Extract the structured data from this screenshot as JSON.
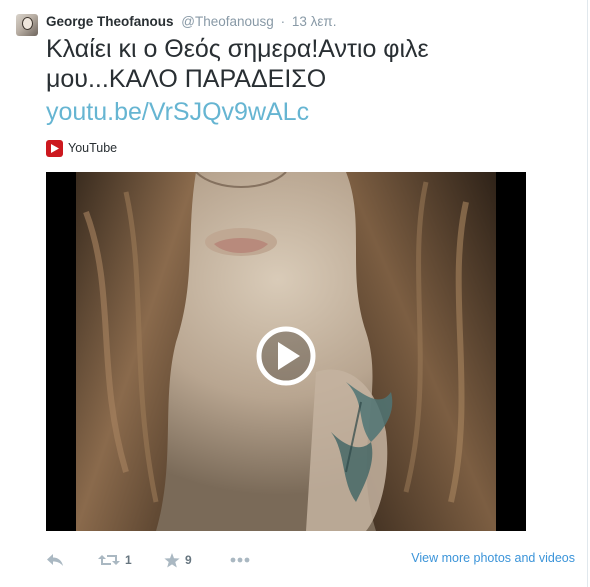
{
  "tweet": {
    "fullname": "George Theofanous",
    "username": "@Theofanousg",
    "separator": "·",
    "time": "13 λεπ.",
    "text": "Κλαίει κι ο Θεός σημερα!Αντιο φιλε μου...ΚΑΛΟ ΠΑΡΑΔΕΙΣΟ",
    "link": "youtu.be/VrSJQv9wALc"
  },
  "card": {
    "source_label": "YouTube",
    "source_icon": "youtube-icon",
    "source_color": "#cc181e"
  },
  "actions": {
    "reply_icon": "reply-icon",
    "retweet_icon": "retweet-icon",
    "retweet_count": "1",
    "favorite_icon": "star-icon",
    "favorite_count": "9",
    "more_icon": "more-dots-icon",
    "view_more": "View more photos and videos"
  },
  "colors": {
    "link": "#66b5d2",
    "muted": "#8899a6",
    "accent": "#3b94d9"
  }
}
